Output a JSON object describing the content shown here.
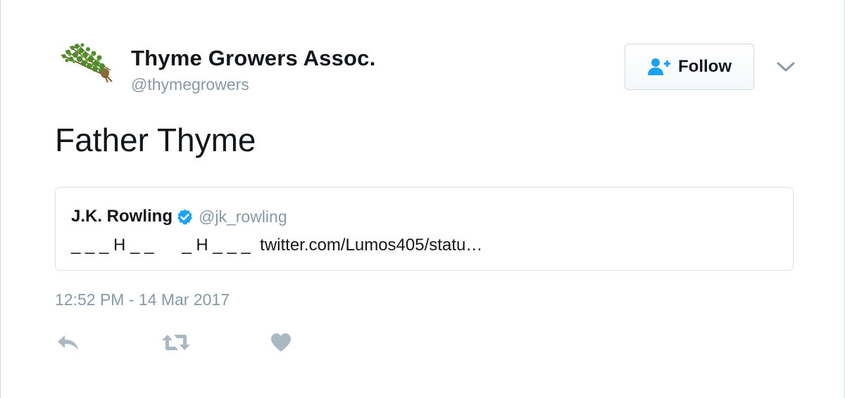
{
  "author": {
    "name": "Thyme Growers Assoc.",
    "handle": "@thymegrowers",
    "avatar_icon": "thyme-bundle-image"
  },
  "follow_button": {
    "label": "Follow",
    "icon": "add-user-icon",
    "accent_color": "#1da1f2"
  },
  "menu_caret": {
    "icon": "chevron-down-icon"
  },
  "tweet": {
    "text": "Father Thyme",
    "timestamp": "12:52 PM - 14 Mar 2017"
  },
  "quoted_tweet": {
    "name": "J.K. Rowling",
    "verified_icon": "verified-badge-icon",
    "handle": "@jk_rowling",
    "text": "_ _ _ H _ _      _ H _ _ _  twitter.com/Lumos405/statu…"
  },
  "actions": [
    {
      "icon": "reply-icon"
    },
    {
      "icon": "retweet-icon"
    },
    {
      "icon": "heart-icon"
    }
  ],
  "colors": {
    "text_primary": "#14171a",
    "text_secondary": "#8899a6",
    "verified_blue": "#1da1f2",
    "action_gray": "#aab8c2"
  }
}
